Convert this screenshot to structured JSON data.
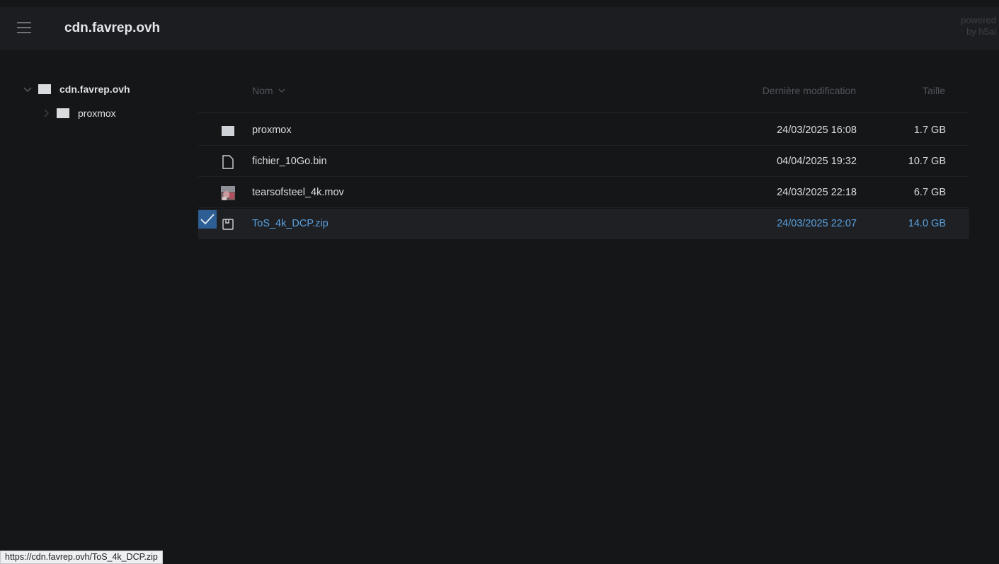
{
  "header": {
    "title": "cdn.favrep.ovh",
    "powered_line1": "powered",
    "powered_line2": "by h5ai"
  },
  "tree": {
    "root_label": "cdn.favrep.ovh",
    "child_label": "proxmox"
  },
  "list": {
    "col_name": "Nom",
    "col_date": "Dernière modification",
    "col_size": "Taille",
    "rows": [
      {
        "name": "proxmox",
        "date": "24/03/2025 16:08",
        "size": "1.7 GB",
        "icon": "folder-icon"
      },
      {
        "name": "fichier_10Go.bin",
        "date": "04/04/2025 19:32",
        "size": "10.7 GB",
        "icon": "file-icon"
      },
      {
        "name": "tearsofsteel_4k.mov",
        "date": "24/03/2025 22:18",
        "size": "6.7 GB",
        "icon": "video-thumbnail-icon"
      },
      {
        "name": "ToS_4k_DCP.zip",
        "date": "24/03/2025 22:07",
        "size": "14.0 GB",
        "icon": "archive-icon",
        "selected": true
      }
    ]
  },
  "status_url": "https://cdn.favrep.ovh/ToS_4k_DCP.zip",
  "colors": {
    "background": "#151618",
    "accent": "#5aa2e0",
    "check_bg": "#2e5f94"
  }
}
